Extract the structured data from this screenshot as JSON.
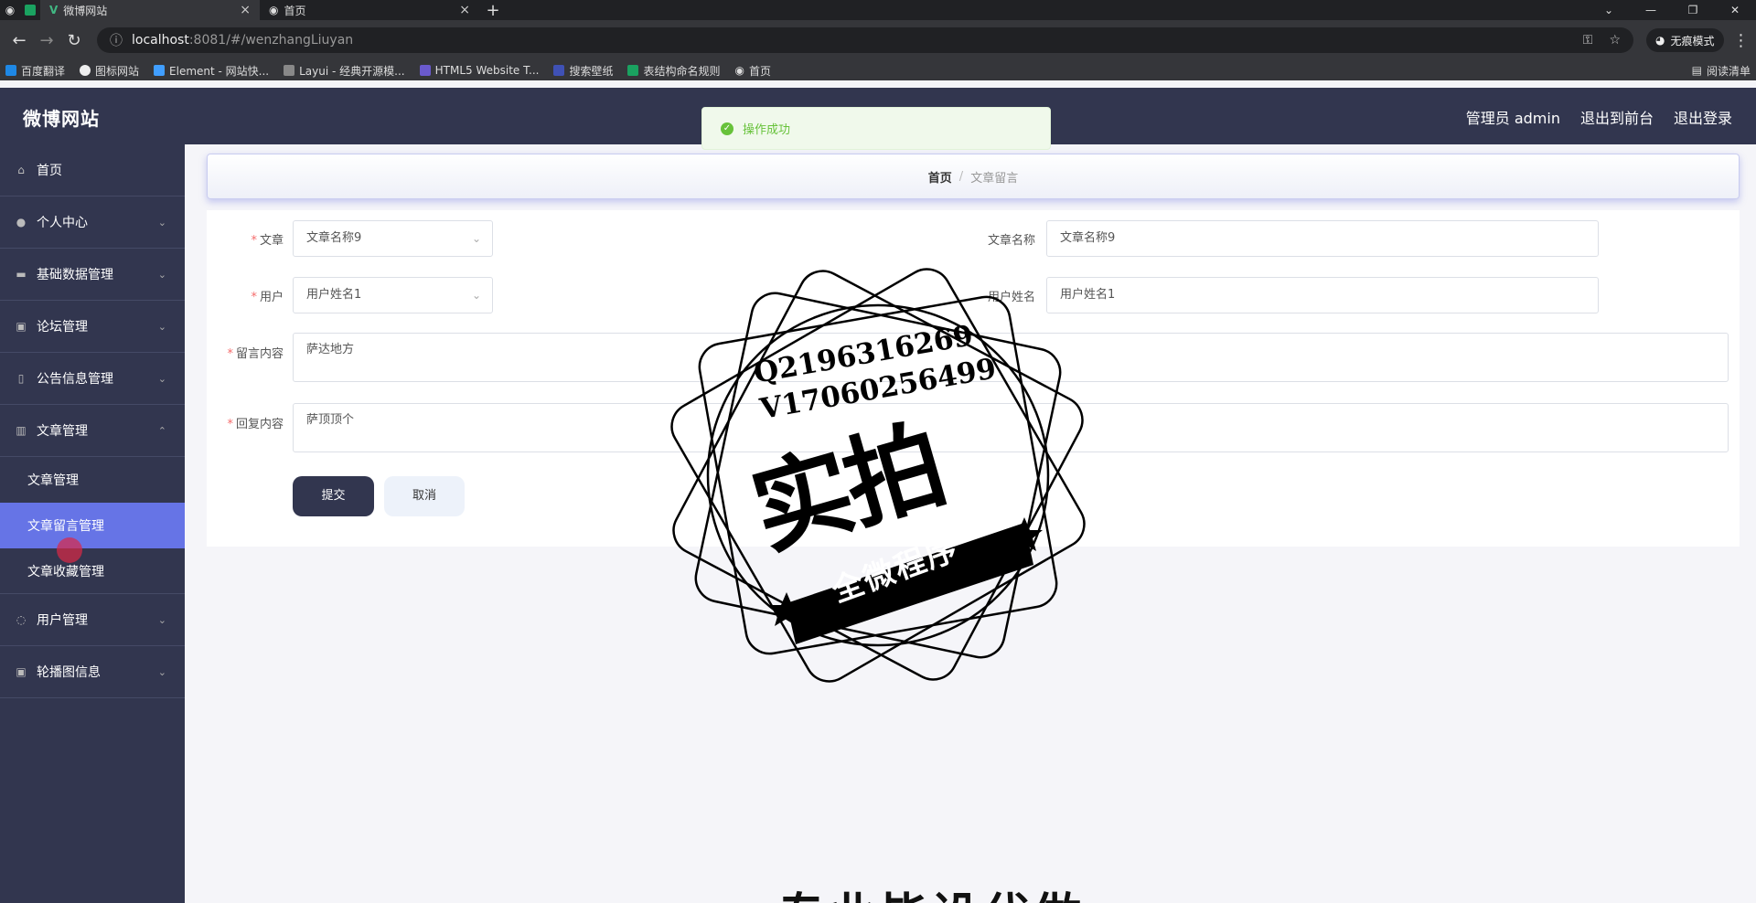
{
  "browser": {
    "tabs": [
      {
        "title": "微博网站",
        "active": true
      },
      {
        "title": "首页",
        "active": false
      }
    ],
    "url_host": "localhost",
    "url_path": ":8081/#/wenzhangLiuyan",
    "incognito_label": "无痕模式",
    "bookmarks": [
      "百度翻译",
      "图标网站",
      "Element - 网站快...",
      "Layui - 经典开源模...",
      "HTML5 Website T...",
      "搜索壁纸",
      "表结构命名规则",
      "首页"
    ],
    "reading_list": "阅读清单"
  },
  "header": {
    "brand": "微博网站",
    "admin": "管理员 admin",
    "back_front": "退出到前台",
    "logout": "退出登录"
  },
  "sidebar": {
    "items": [
      {
        "label": "首页"
      },
      {
        "label": "个人中心"
      },
      {
        "label": "基础数据管理"
      },
      {
        "label": "论坛管理"
      },
      {
        "label": "公告信息管理"
      },
      {
        "label": "文章管理"
      },
      {
        "label": "用户管理"
      },
      {
        "label": "轮播图信息"
      }
    ],
    "sub": [
      {
        "label": "文章管理"
      },
      {
        "label": "文章留言管理"
      },
      {
        "label": "文章收藏管理"
      }
    ]
  },
  "breadcrumb": {
    "home": "首页",
    "sep": "/",
    "current": "文章留言"
  },
  "toast": {
    "text": "操作成功"
  },
  "form": {
    "article_label": "文章",
    "article_value": "文章名称9",
    "article_name_label": "文章名称",
    "article_name_value": "文章名称9",
    "user_label": "用户",
    "user_value": "用户姓名1",
    "user_name_label": "用户姓名",
    "user_name_value": "用户姓名1",
    "message_label": "留言内容",
    "message_value": "萨达地方",
    "reply_label": "回复内容",
    "reply_value": "萨顶顶个",
    "submit": "提交",
    "cancel": "取消"
  },
  "watermark": {
    "q": "Q2196316269",
    "v": "V17060256499",
    "big": "实拍",
    "ribbon": "全微程序",
    "bottom": "专业毕设代做"
  }
}
